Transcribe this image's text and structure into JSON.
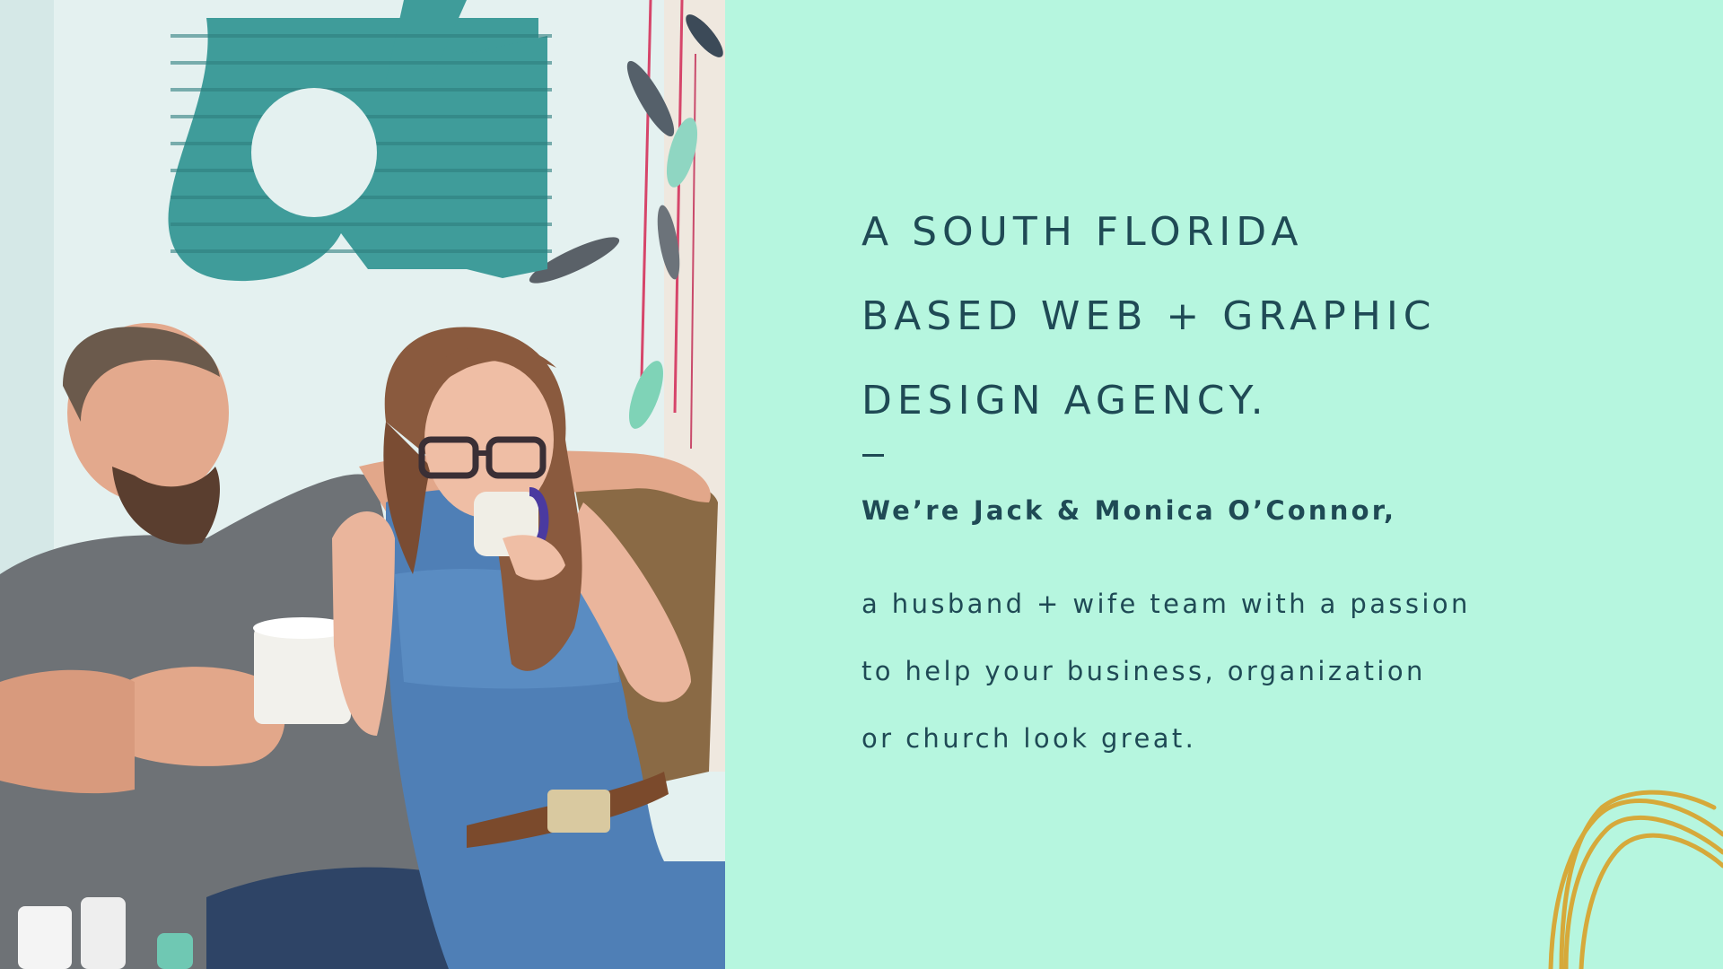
{
  "hero": {
    "headline_lines": [
      "A SOUTH FLORIDA",
      "BASED WEB + GRAPHIC",
      "DESIGN AGENCY."
    ],
    "intro": "We’re Jack & Monica O’Connor,",
    "body_lines": [
      "a husband + wife team with a passion",
      "to help your business, organization",
      "or church look great."
    ]
  },
  "colors": {
    "background": "#b6f6df",
    "text": "#1f4a55",
    "accent_gold": "#d6a93a"
  }
}
